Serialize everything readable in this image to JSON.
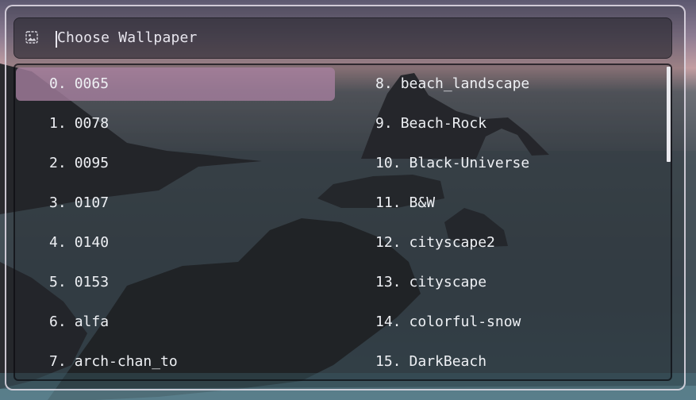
{
  "search": {
    "placeholder": "Choose Wallpaper",
    "icon": "image-icon"
  },
  "colors": {
    "selected_bg": "#a880a0",
    "text": "#eef0f4",
    "border": "#e6e1eb"
  },
  "list": {
    "selected_index": 0,
    "scroll_position": 0,
    "items": [
      {
        "index": "0.",
        "name": "0065"
      },
      {
        "index": "1.",
        "name": "0078"
      },
      {
        "index": "2.",
        "name": "0095"
      },
      {
        "index": "3.",
        "name": "0107"
      },
      {
        "index": "4.",
        "name": "0140"
      },
      {
        "index": "5.",
        "name": "0153"
      },
      {
        "index": "6.",
        "name": "alfa"
      },
      {
        "index": "7.",
        "name": "arch-chan_to"
      },
      {
        "index": "8.",
        "name": "beach_landscape"
      },
      {
        "index": "9.",
        "name": "Beach-Rock"
      },
      {
        "index": "10.",
        "name": "Black-Universe"
      },
      {
        "index": "11.",
        "name": "B&W"
      },
      {
        "index": "12.",
        "name": "cityscape2"
      },
      {
        "index": "13.",
        "name": "cityscape"
      },
      {
        "index": "14.",
        "name": "colorful-snow"
      },
      {
        "index": "15.",
        "name": "DarkBeach"
      }
    ]
  }
}
